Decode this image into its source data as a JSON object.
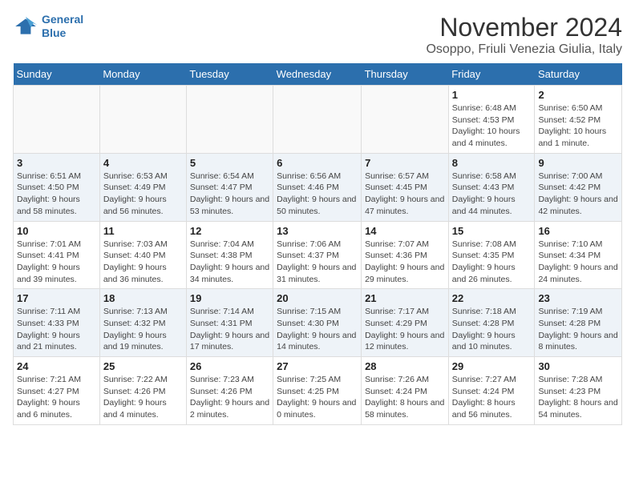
{
  "header": {
    "logo_line1": "General",
    "logo_line2": "Blue",
    "month_title": "November 2024",
    "subtitle": "Osoppo, Friuli Venezia Giulia, Italy"
  },
  "weekdays": [
    "Sunday",
    "Monday",
    "Tuesday",
    "Wednesday",
    "Thursday",
    "Friday",
    "Saturday"
  ],
  "weeks": [
    [
      {
        "day": "",
        "info": ""
      },
      {
        "day": "",
        "info": ""
      },
      {
        "day": "",
        "info": ""
      },
      {
        "day": "",
        "info": ""
      },
      {
        "day": "",
        "info": ""
      },
      {
        "day": "1",
        "info": "Sunrise: 6:48 AM\nSunset: 4:53 PM\nDaylight: 10 hours and 4 minutes."
      },
      {
        "day": "2",
        "info": "Sunrise: 6:50 AM\nSunset: 4:52 PM\nDaylight: 10 hours and 1 minute."
      }
    ],
    [
      {
        "day": "3",
        "info": "Sunrise: 6:51 AM\nSunset: 4:50 PM\nDaylight: 9 hours and 58 minutes."
      },
      {
        "day": "4",
        "info": "Sunrise: 6:53 AM\nSunset: 4:49 PM\nDaylight: 9 hours and 56 minutes."
      },
      {
        "day": "5",
        "info": "Sunrise: 6:54 AM\nSunset: 4:47 PM\nDaylight: 9 hours and 53 minutes."
      },
      {
        "day": "6",
        "info": "Sunrise: 6:56 AM\nSunset: 4:46 PM\nDaylight: 9 hours and 50 minutes."
      },
      {
        "day": "7",
        "info": "Sunrise: 6:57 AM\nSunset: 4:45 PM\nDaylight: 9 hours and 47 minutes."
      },
      {
        "day": "8",
        "info": "Sunrise: 6:58 AM\nSunset: 4:43 PM\nDaylight: 9 hours and 44 minutes."
      },
      {
        "day": "9",
        "info": "Sunrise: 7:00 AM\nSunset: 4:42 PM\nDaylight: 9 hours and 42 minutes."
      }
    ],
    [
      {
        "day": "10",
        "info": "Sunrise: 7:01 AM\nSunset: 4:41 PM\nDaylight: 9 hours and 39 minutes."
      },
      {
        "day": "11",
        "info": "Sunrise: 7:03 AM\nSunset: 4:40 PM\nDaylight: 9 hours and 36 minutes."
      },
      {
        "day": "12",
        "info": "Sunrise: 7:04 AM\nSunset: 4:38 PM\nDaylight: 9 hours and 34 minutes."
      },
      {
        "day": "13",
        "info": "Sunrise: 7:06 AM\nSunset: 4:37 PM\nDaylight: 9 hours and 31 minutes."
      },
      {
        "day": "14",
        "info": "Sunrise: 7:07 AM\nSunset: 4:36 PM\nDaylight: 9 hours and 29 minutes."
      },
      {
        "day": "15",
        "info": "Sunrise: 7:08 AM\nSunset: 4:35 PM\nDaylight: 9 hours and 26 minutes."
      },
      {
        "day": "16",
        "info": "Sunrise: 7:10 AM\nSunset: 4:34 PM\nDaylight: 9 hours and 24 minutes."
      }
    ],
    [
      {
        "day": "17",
        "info": "Sunrise: 7:11 AM\nSunset: 4:33 PM\nDaylight: 9 hours and 21 minutes."
      },
      {
        "day": "18",
        "info": "Sunrise: 7:13 AM\nSunset: 4:32 PM\nDaylight: 9 hours and 19 minutes."
      },
      {
        "day": "19",
        "info": "Sunrise: 7:14 AM\nSunset: 4:31 PM\nDaylight: 9 hours and 17 minutes."
      },
      {
        "day": "20",
        "info": "Sunrise: 7:15 AM\nSunset: 4:30 PM\nDaylight: 9 hours and 14 minutes."
      },
      {
        "day": "21",
        "info": "Sunrise: 7:17 AM\nSunset: 4:29 PM\nDaylight: 9 hours and 12 minutes."
      },
      {
        "day": "22",
        "info": "Sunrise: 7:18 AM\nSunset: 4:28 PM\nDaylight: 9 hours and 10 minutes."
      },
      {
        "day": "23",
        "info": "Sunrise: 7:19 AM\nSunset: 4:28 PM\nDaylight: 9 hours and 8 minutes."
      }
    ],
    [
      {
        "day": "24",
        "info": "Sunrise: 7:21 AM\nSunset: 4:27 PM\nDaylight: 9 hours and 6 minutes."
      },
      {
        "day": "25",
        "info": "Sunrise: 7:22 AM\nSunset: 4:26 PM\nDaylight: 9 hours and 4 minutes."
      },
      {
        "day": "26",
        "info": "Sunrise: 7:23 AM\nSunset: 4:26 PM\nDaylight: 9 hours and 2 minutes."
      },
      {
        "day": "27",
        "info": "Sunrise: 7:25 AM\nSunset: 4:25 PM\nDaylight: 9 hours and 0 minutes."
      },
      {
        "day": "28",
        "info": "Sunrise: 7:26 AM\nSunset: 4:24 PM\nDaylight: 8 hours and 58 minutes."
      },
      {
        "day": "29",
        "info": "Sunrise: 7:27 AM\nSunset: 4:24 PM\nDaylight: 8 hours and 56 minutes."
      },
      {
        "day": "30",
        "info": "Sunrise: 7:28 AM\nSunset: 4:23 PM\nDaylight: 8 hours and 54 minutes."
      }
    ]
  ]
}
